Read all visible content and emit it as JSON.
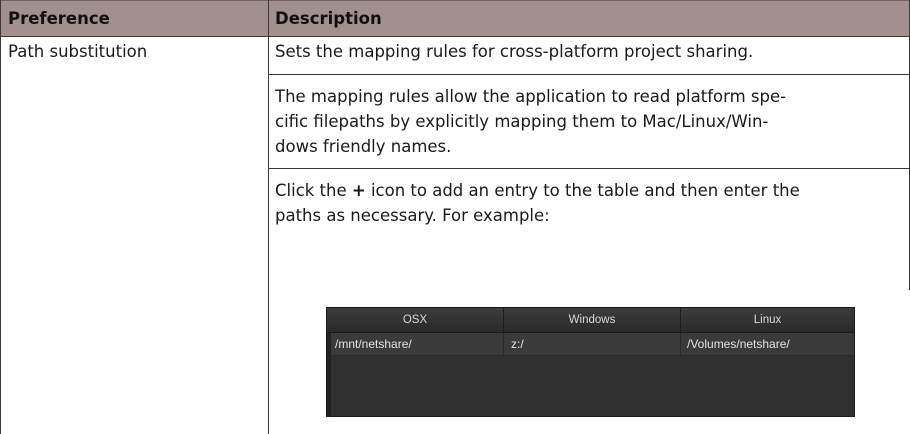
{
  "table": {
    "header": {
      "preference": "Preference",
      "description": "Description"
    },
    "row": {
      "preference": "Path substitution",
      "paragraph1": "Sets the mapping rules for cross-platform project sharing.",
      "paragraph2_lines": [
        "The mapping rules allow the application to read platform spe-",
        "cific filepaths by explicitly mapping them to Mac/Linux/Win-",
        "dows friendly names."
      ],
      "paragraph3": {
        "before_icon": "Click the ",
        "icon_glyph": "+",
        "line1_after": " icon to add an entry to the table and then enter the",
        "line2": "paths as necessary. For example:"
      }
    }
  },
  "example_table": {
    "columns": [
      "OSX",
      "Windows",
      "Linux"
    ],
    "rows": [
      [
        "/mnt/netshare/",
        "z:/",
        "/Volumes/netshare/"
      ]
    ]
  },
  "colors": {
    "header_bg": "#a1908d",
    "example_table_bg": "#303030"
  }
}
